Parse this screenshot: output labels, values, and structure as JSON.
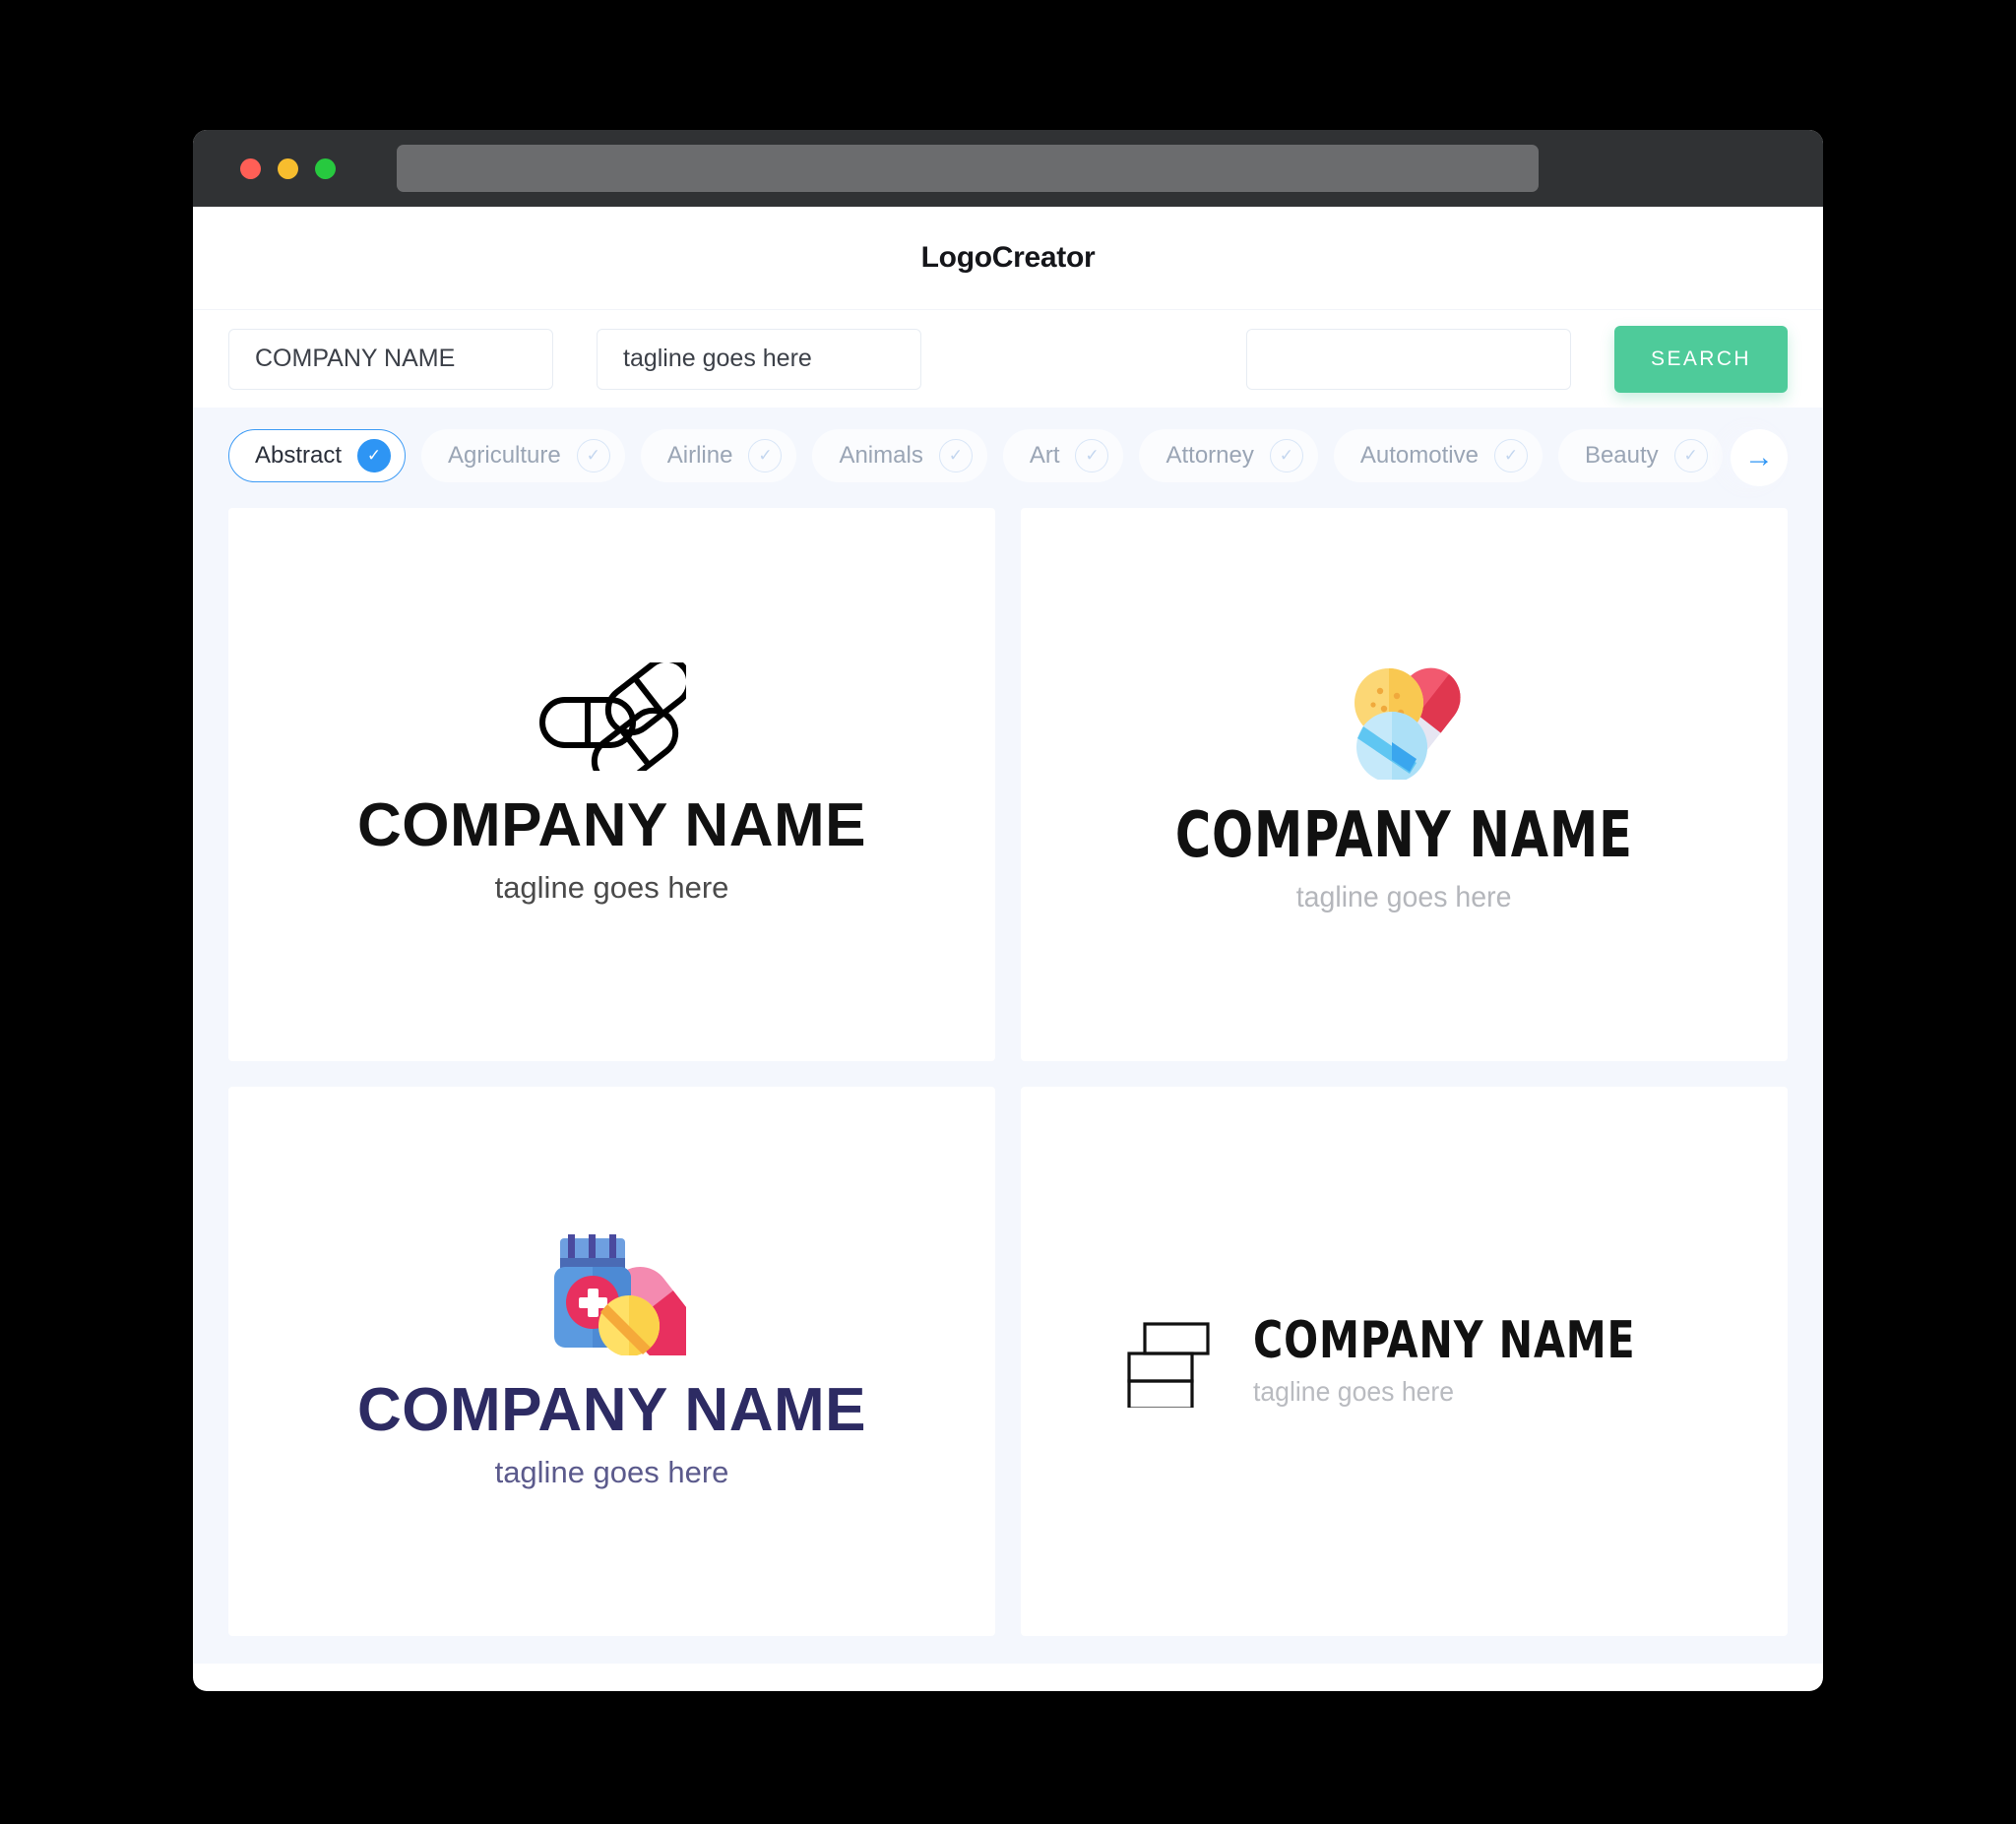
{
  "window": {
    "traffic_lights": [
      "close",
      "minimize",
      "maximize"
    ],
    "url_value": ""
  },
  "header": {
    "title": "LogoCreator"
  },
  "search": {
    "company_value": "COMPANY NAME",
    "company_placeholder": "COMPANY NAME",
    "tagline_value": "tagline goes here",
    "tagline_placeholder": "tagline goes here",
    "extra_value": "",
    "extra_placeholder": "",
    "button_label": "SEARCH",
    "button_color": "#4ecb9a"
  },
  "categories": {
    "active_index": 0,
    "accent_color": "#2e95f4",
    "next_icon": "arrow-right-icon",
    "items": [
      {
        "label": "Abstract",
        "selected": true
      },
      {
        "label": "Agriculture",
        "selected": false
      },
      {
        "label": "Airline",
        "selected": false
      },
      {
        "label": "Animals",
        "selected": false
      },
      {
        "label": "Art",
        "selected": false
      },
      {
        "label": "Attorney",
        "selected": false
      },
      {
        "label": "Automotive",
        "selected": false
      },
      {
        "label": "Beauty",
        "selected": false
      }
    ]
  },
  "results": [
    {
      "icon": "three-capsules-outline-icon",
      "name": "COMPANY NAME",
      "tagline": "tagline goes here",
      "style": "block-bold-centered",
      "name_color": "#111111",
      "tagline_color": "#4a4a4a"
    },
    {
      "icon": "colored-pills-icon",
      "name": "COMPANY NAME",
      "tagline": "tagline goes here",
      "style": "condensed-centered",
      "name_color": "#111111",
      "tagline_color": "#b4b6bb"
    },
    {
      "icon": "medicine-bottle-pills-icon",
      "name": "COMPANY NAME",
      "tagline": "tagline goes here",
      "style": "navy-centered",
      "name_color": "#2d2b63",
      "tagline_color": "#5b5a8c"
    },
    {
      "icon": "stacked-rectangles-outline-icon",
      "name": "COMPANY NAME",
      "tagline": "tagline goes here",
      "style": "condensed-horizontal",
      "name_color": "#111111",
      "tagline_color": "#b9bbc0"
    }
  ]
}
